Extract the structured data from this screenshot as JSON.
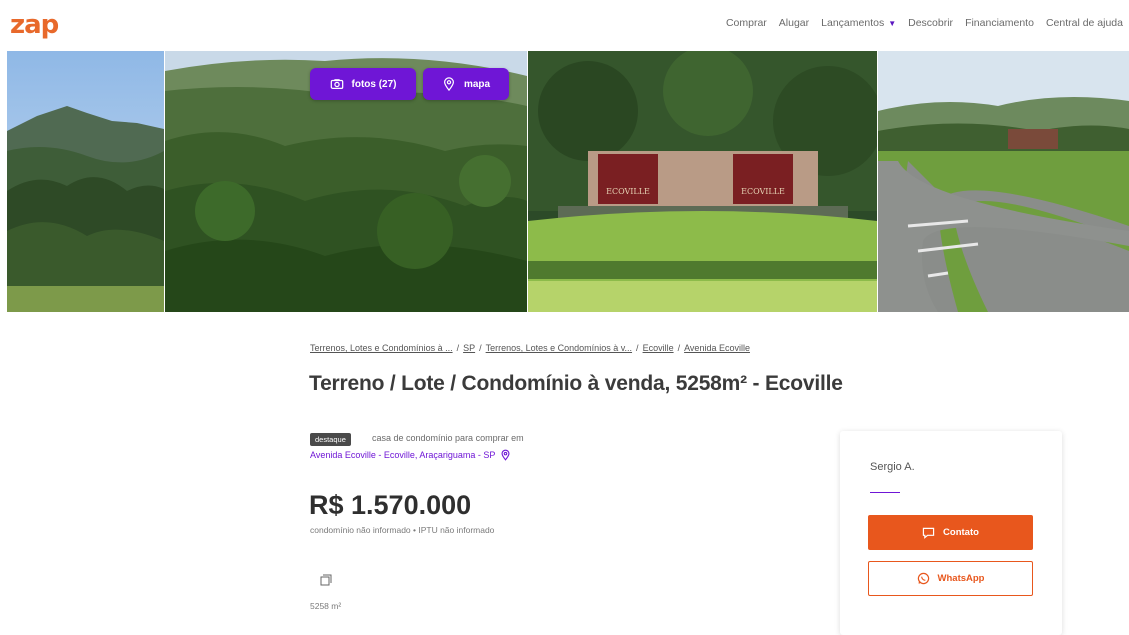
{
  "header": {
    "logo": "zap",
    "nav": {
      "comprar": "Comprar",
      "alugar": "Alugar",
      "lancamentos": "Lançamentos",
      "descobrir": "Descobrir",
      "financiamento": "Financiamento",
      "central_ajuda": "Central de ajuda"
    }
  },
  "gallery": {
    "photos_button": "fotos (27)",
    "map_button": "mapa",
    "sign_text": "ECOVILLE"
  },
  "breadcrumb": {
    "items": [
      "Terrenos, Lotes e Condomínios à ...",
      "SP",
      "Terrenos, Lotes e Condomínios à v...",
      "Ecoville",
      "Avenida Ecoville"
    ],
    "separator": "/"
  },
  "listing": {
    "title": "Terreno / Lote / Condomínio à venda, 5258m² - Ecoville",
    "badge": "destaque",
    "subtype": "casa de condomínio para comprar em",
    "address": "Avenida Ecoville - Ecoville, Araçariguama - SP",
    "price": "R$ 1.570.000",
    "fees": "condomínio não informado  •  IPTU não informado",
    "area": "5258 m²"
  },
  "contact_card": {
    "agent_name": "Sergio A.",
    "contact_button": "Contato",
    "whatsapp_button": "WhatsApp"
  },
  "colors": {
    "brand_orange": "#e8571d",
    "brand_purple": "#6f16d6",
    "logo": "#e8692b"
  }
}
